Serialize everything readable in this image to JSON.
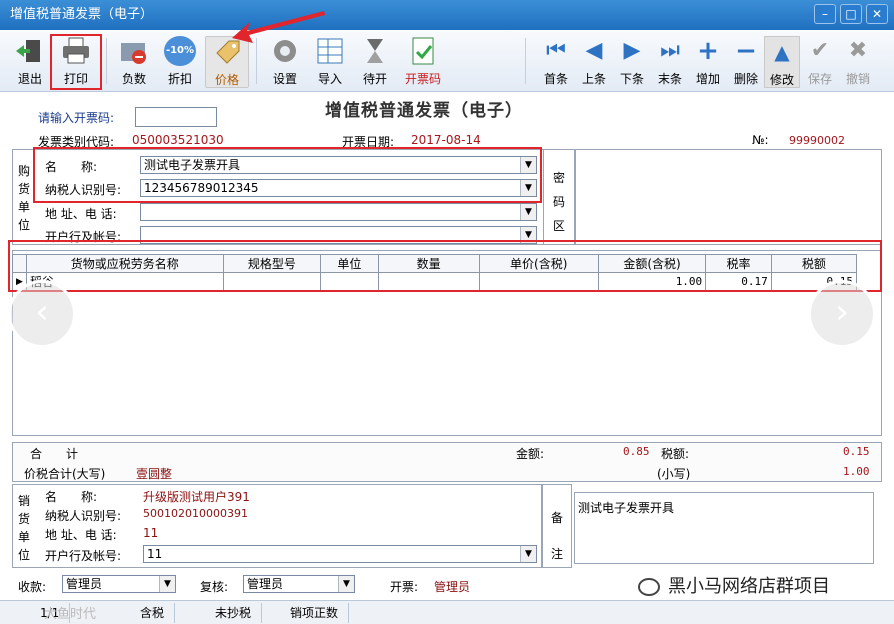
{
  "window": {
    "title": "增值税普通发票（电子）"
  },
  "toolbar": {
    "exit": "退出",
    "print": "打印",
    "negative": "负数",
    "discount": "折扣",
    "discount_badge": "-10%",
    "price": "价格",
    "settings": "设置",
    "import": "导入",
    "hold": "待开",
    "invoice_code": "开票码",
    "first": "首条",
    "prev": "上条",
    "next": "下条",
    "last": "末条",
    "add": "增加",
    "delete": "删除",
    "edit": "修改",
    "save": "保存",
    "undo": "撤销"
  },
  "header": {
    "heading": "增值税普通发票（电子）",
    "enter_code_label": "请输入开票码:",
    "enter_code_value": "",
    "category_code_label": "发票类别代码:",
    "category_code_value": "050003521030",
    "date_label": "开票日期:",
    "date_value": "2017-08-14",
    "no_label": "№:",
    "no_value": "99990002"
  },
  "buyer": {
    "side_label": [
      "购",
      "货",
      "单",
      "位"
    ],
    "name_label": "名　　称:",
    "name_value": "测试电子发票开具",
    "tax_id_label": "纳税人识别号:",
    "tax_id_value": "123456789012345",
    "address_label": "地 址、电 话:",
    "address_value": "",
    "bank_label": "开户行及帐号:",
    "bank_value": "",
    "cipher_label": [
      "密",
      "码",
      "区"
    ]
  },
  "items": {
    "columns": [
      "货物或应税劳务名称",
      "规格型号",
      "单位",
      "数量",
      "单价(含税)",
      "金额(含税)",
      "税率",
      "税额"
    ],
    "rows": [
      {
        "name": "稻谷",
        "spec": "",
        "unit": "",
        "qty": "",
        "price": "",
        "amount": "1.00",
        "rate": "0.17",
        "tax": "0.15"
      }
    ]
  },
  "totals": {
    "sum_label": "合　　计",
    "amount_label": "金额:",
    "amount_value": "0.85",
    "tax_label": "税额:",
    "tax_value": "0.15",
    "grand_label": "价税合计(大写)",
    "grand_words": "壹圆整",
    "small_label": "(小写)",
    "small_value": "1.00"
  },
  "seller": {
    "side_label": [
      "销",
      "货",
      "单",
      "位"
    ],
    "name_label": "名　　称:",
    "name_value": "升级版测试用户391",
    "tax_id_label": "纳税人识别号:",
    "tax_id_value": "500102010000391",
    "address_label": "地 址、电 话:",
    "address_value": "11",
    "bank_label": "开户行及帐号:",
    "bank_value": "11",
    "remark_label": [
      "备",
      "注"
    ],
    "remark_value": "测试电子发票开具"
  },
  "signers": {
    "payee_label": "收款:",
    "payee_value": "管理员",
    "review_label": "复核:",
    "review_value": "管理员",
    "drawer_label": "开票:",
    "drawer_value": "管理员"
  },
  "status": {
    "page": "1/1",
    "tabs": [
      "含税",
      "未抄税",
      "销项正数"
    ],
    "watermark": "大鱼时代"
  },
  "brand": {
    "watermark": "黑小马网络店群项目"
  },
  "colors": {
    "titlebar": "#1f6fc0",
    "highlight": "#e0262c",
    "value_red": "#a5161b"
  }
}
